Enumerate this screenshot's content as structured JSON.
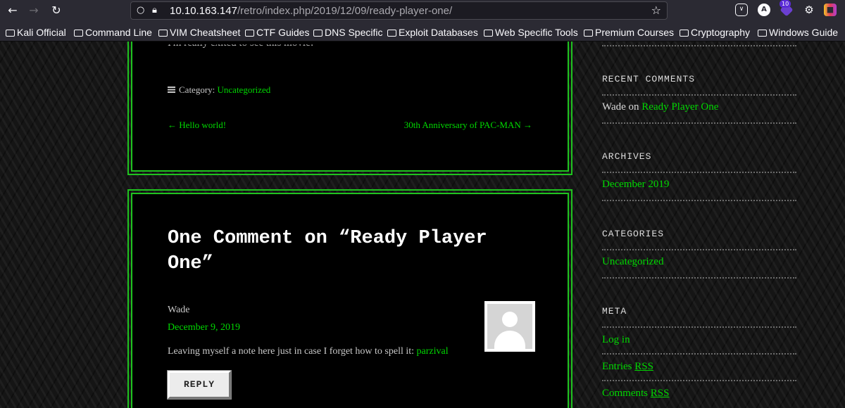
{
  "browser": {
    "url_host": "10.10.163.147",
    "url_path": "/retro/index.php/2019/12/09/ready-player-one/",
    "extension_badge": "10",
    "bookmarks": [
      "Kali Official",
      "Command Line",
      "VIM Cheatsheet",
      "CTF Guides",
      "DNS Specific",
      "Exploit Databases",
      "Web Specific Tools",
      "Premium Courses",
      "Cryptography",
      "Windows Guide"
    ]
  },
  "post": {
    "cut_text": "I'm really exited to see this movie!",
    "category_label": "Category:",
    "category_value": "Uncategorized",
    "prev_link": "← Hello world!",
    "next_link": "30th Anniversary of PAC-MAN →"
  },
  "comments": {
    "title": "One Comment on “Ready Player One”",
    "author": "Wade",
    "date": "December 9, 2019",
    "text_prefix": "Leaving myself a note here just in case I forget how to spell it: ",
    "text_link": "parzival",
    "reply_label": "REPLY"
  },
  "sidebar": {
    "recent_comments_title": "RECENT COMMENTS",
    "recent_author": "Wade",
    "recent_on": " on ",
    "recent_post": "Ready Player One",
    "archives_title": "ARCHIVES",
    "archive_item": "December 2019",
    "categories_title": "CATEGORIES",
    "category_item": "Uncategorized",
    "meta_title": "META",
    "meta_login": "Log in",
    "meta_entries": "Entries ",
    "meta_comments": "Comments ",
    "meta_rss": "RSS"
  },
  "colors": {
    "accent_green": "#00d800",
    "panel_border": "#1fc31f",
    "panel_bg": "#000000"
  }
}
